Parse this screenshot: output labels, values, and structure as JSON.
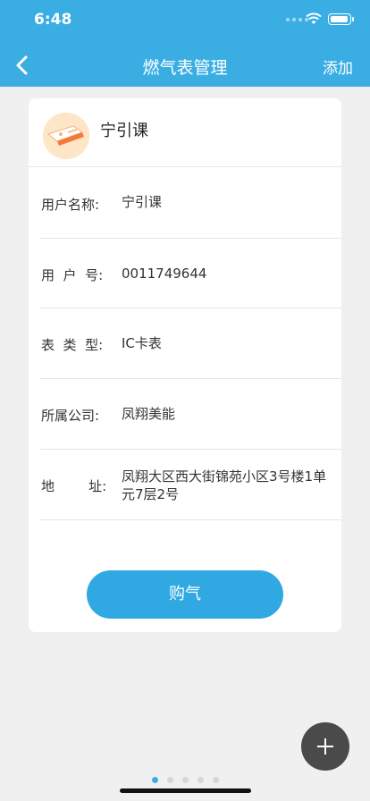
{
  "status_bar": {
    "time": "6:48"
  },
  "nav": {
    "title": "燃气表管理",
    "action": "添加"
  },
  "card": {
    "name": "宁引课",
    "rows": [
      {
        "label": "用户名称:",
        "value": "宁引课"
      },
      {
        "label": "用  户  号:",
        "value": "0011749644"
      },
      {
        "label": "表  类  型:",
        "value": "IC卡表"
      },
      {
        "label": "所属公司:",
        "value": "凤翔美能"
      },
      {
        "label": "地        址:",
        "value": "凤翔大区西大街锦苑小区3号楼1单元7层2号"
      }
    ],
    "buy_button": "购气"
  },
  "pager": {
    "count": 5,
    "active": 0
  },
  "icons": {
    "back": "chevron-left-icon",
    "fab": "plus-icon"
  },
  "colors": {
    "header": "#3aaee3",
    "button": "#30a8e2",
    "fab": "#4a4a4a"
  }
}
